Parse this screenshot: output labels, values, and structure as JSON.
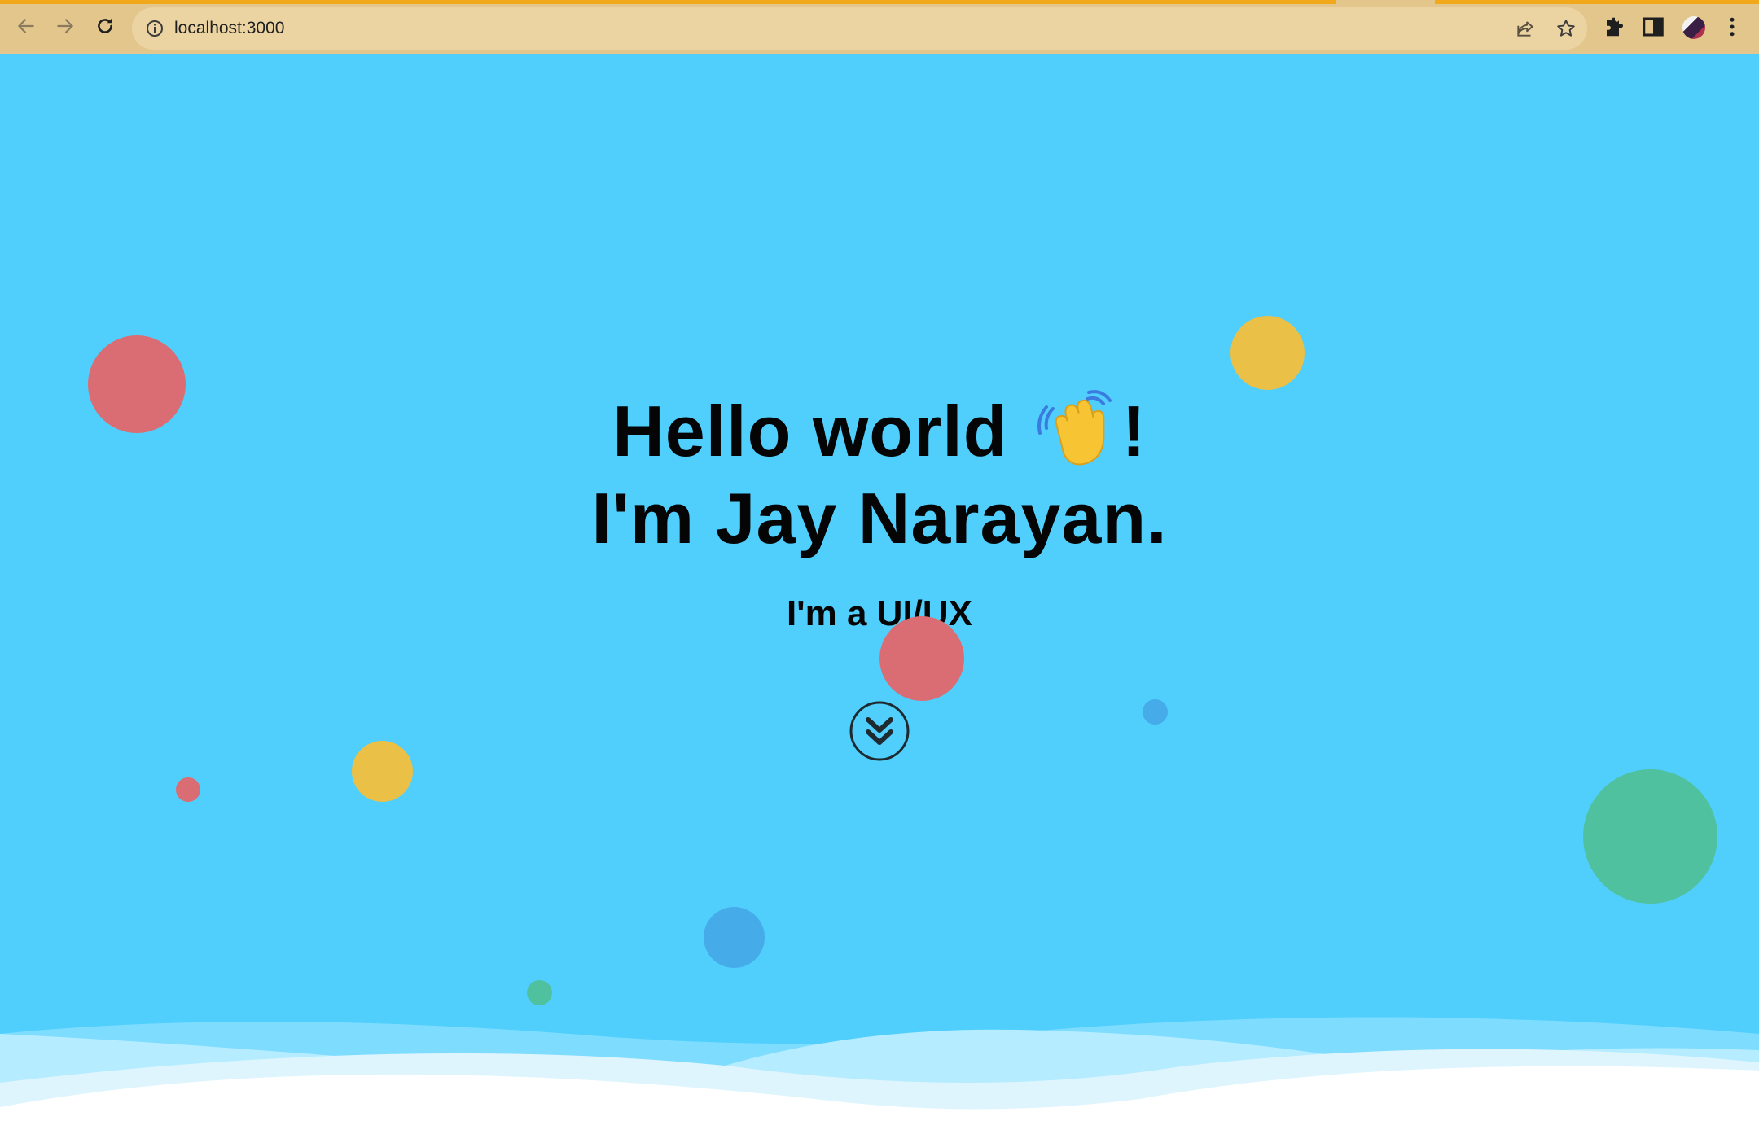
{
  "browser": {
    "url": "localhost:3000",
    "icons": [
      "back-arrow-icon",
      "forward-arrow-icon",
      "reload-icon",
      "info-icon",
      "share-icon",
      "star-icon",
      "extensions-puzzle-icon",
      "side-panel-icon",
      "profile-avatar",
      "kebab-menu-icon"
    ]
  },
  "hero": {
    "greeting": "Hello world",
    "exclaim": "!",
    "name_line": "I'm Jay Narayan.",
    "subtitle": "I'm a UI/UX",
    "wave_icon": "waving-hand-icon",
    "scroll_icon": "double-chevron-down-icon"
  },
  "colors": {
    "background": "#50cffd",
    "chrome_bar": "#e2c68c",
    "load_bar": "#f2a81b",
    "bubble_red": "#da6d73",
    "bubble_yellow": "#ebc046",
    "bubble_blue": "#46abe9",
    "bubble_green": "#50c19f"
  }
}
